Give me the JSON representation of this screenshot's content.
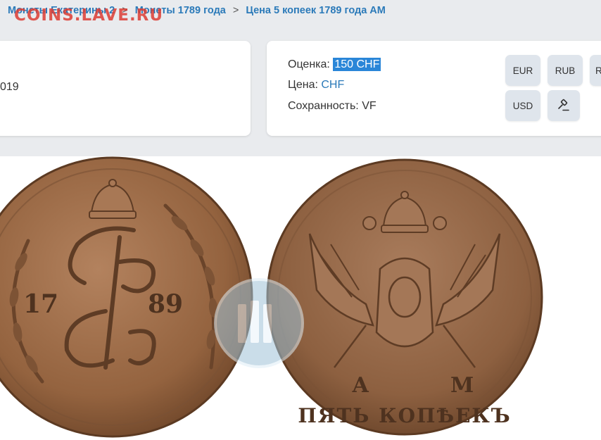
{
  "breadcrumb": {
    "items": [
      "Монеты Екатерины 2",
      "Монеты 1789 года",
      "Цена 5 копеек 1789 года АМ"
    ],
    "separator": ">"
  },
  "watermark": "COINS.LAVE.RU",
  "left_card": {
    "year_fragment": "019"
  },
  "info": {
    "estimate_label": "Оценка:",
    "estimate_value": "150 CHF",
    "price_label": "Цена:",
    "price_value": "CHF",
    "grade_label": "Сохранность:",
    "grade_value": "VF"
  },
  "currencies": [
    "EUR",
    "RUB",
    "R",
    "USD"
  ],
  "auction_icon": "gavel-icon",
  "coins": {
    "obverse_year_left": "17",
    "obverse_year_right": "89",
    "reverse_letters_left": "А",
    "reverse_letters_right": "М",
    "reverse_legend": "ПЯТЬ КОПѢЕКЪ",
    "colors": {
      "bronze": "#9a6a4a",
      "bronze_dark": "#6e4730",
      "bronze_light": "#b98a68"
    }
  },
  "colors": {
    "link": "#2b7ab9",
    "band": "#e9ebee",
    "button": "#dfe5ec"
  }
}
